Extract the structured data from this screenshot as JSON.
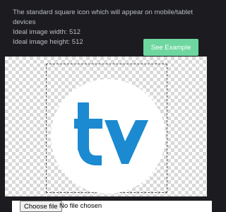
{
  "description": {
    "line1": "The standard square icon which will appear on mobile/tablet",
    "line2": "devices",
    "width_label": "Ideal image width: 512",
    "height_label": "Ideal image height: 512"
  },
  "see_example_label": "See Example",
  "logo": {
    "name": "tv-logo",
    "brand_color": "#1b8ad0"
  },
  "file_input": {
    "button_label": "Choose file",
    "status": "No file chosen"
  },
  "colors": {
    "background": "#1c1c20",
    "text": "#b9bcc2",
    "accent_button": "#6ed7a0"
  }
}
